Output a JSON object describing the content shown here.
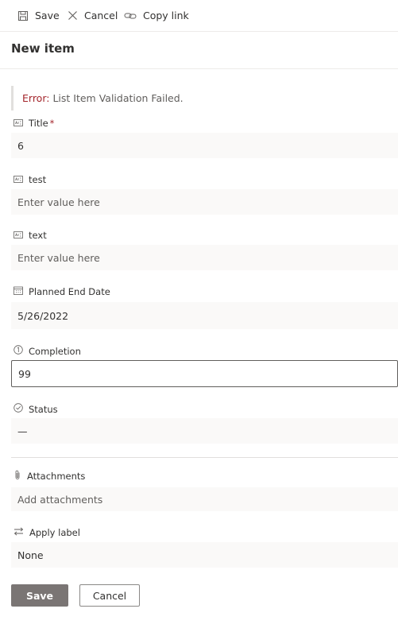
{
  "toolbar": {
    "save_label": "Save",
    "cancel_label": "Cancel",
    "copy_link_label": "Copy link"
  },
  "form": {
    "title": "New item",
    "error_label": "Error:",
    "error_message": "List Item Validation Failed.",
    "required_marker": "*",
    "fields": {
      "title": {
        "label": "Title",
        "value": "6"
      },
      "test": {
        "label": "test",
        "placeholder": "Enter value here"
      },
      "text": {
        "label": "text",
        "placeholder": "Enter value here"
      },
      "planned_end_date": {
        "label": "Planned End Date",
        "value": "5/26/2022"
      },
      "completion": {
        "label": "Completion",
        "value": "99"
      },
      "status": {
        "label": "Status",
        "value": "—"
      },
      "attachments": {
        "label": "Attachments",
        "placeholder": "Add attachments"
      },
      "apply_label": {
        "label": "Apply label",
        "value": "None"
      }
    },
    "save_button": "Save",
    "cancel_button": "Cancel"
  },
  "colors": {
    "error": "#a4262c",
    "primary_button": "#7a7574",
    "input_background": "#faf9f8"
  }
}
